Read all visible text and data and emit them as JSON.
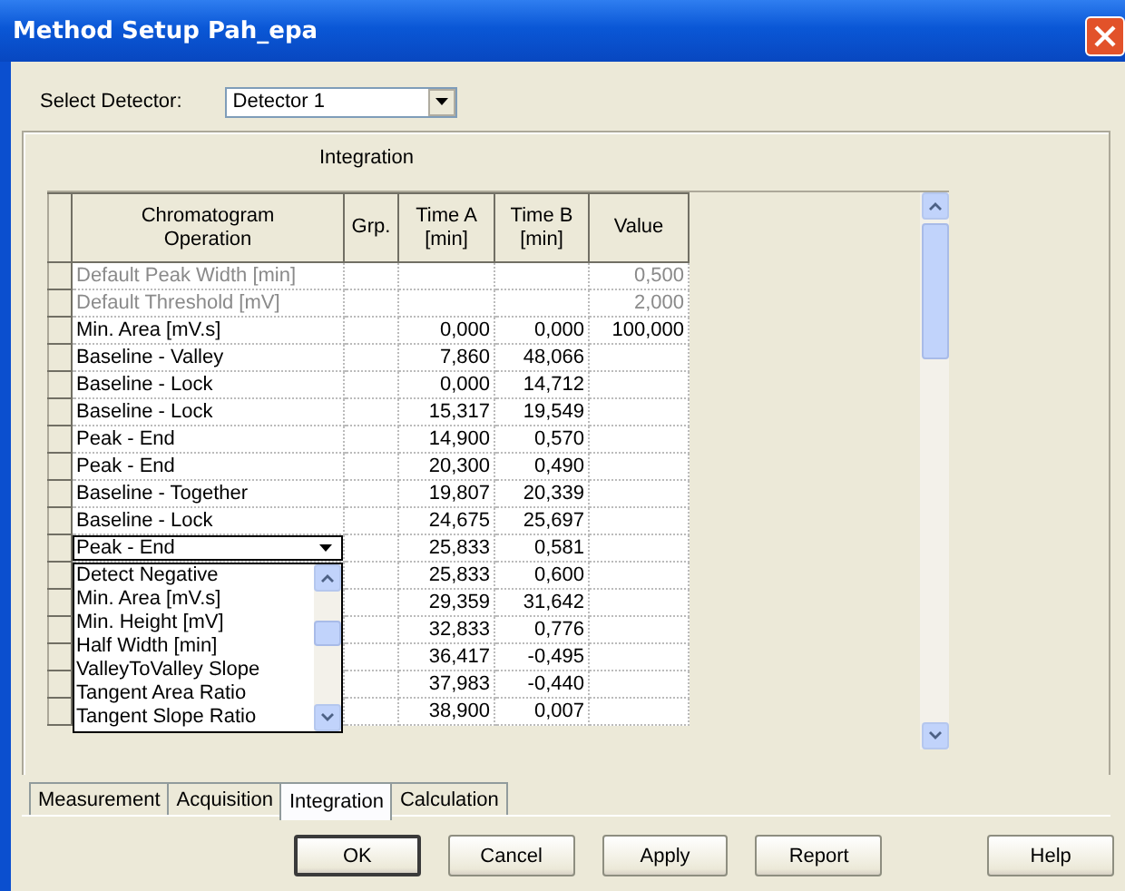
{
  "window": {
    "title": "Method Setup Pah_epa"
  },
  "detector": {
    "label": "Select Detector:",
    "value": "Detector 1"
  },
  "panel_title": "Integration",
  "grid": {
    "columns": [
      "Chromatogram\nOperation",
      "Grp.",
      "Time A\n[min]",
      "Time B\n[min]",
      "Value"
    ],
    "rows": [
      {
        "kind": "default",
        "operation": "Default Peak Width [min]",
        "value": "0,500"
      },
      {
        "kind": "default",
        "operation": "Default Threshold [mV]",
        "value": "2,000"
      },
      {
        "kind": "normal",
        "operation": "Min. Area [mV.s]",
        "time_a": "0,000",
        "time_b": "0,000",
        "value": "100,000"
      },
      {
        "kind": "normal",
        "operation": "Baseline - Valley",
        "time_a": "7,860",
        "time_b": "48,066"
      },
      {
        "kind": "normal",
        "operation": "Baseline - Lock",
        "time_a": "0,000",
        "time_b": "14,712"
      },
      {
        "kind": "normal",
        "operation": "Baseline - Lock",
        "time_a": "15,317",
        "time_b": "19,549"
      },
      {
        "kind": "normal",
        "operation": "Peak - End",
        "time_a": "14,900",
        "time_b": "0,570"
      },
      {
        "kind": "normal",
        "operation": "Peak - End",
        "time_a": "20,300",
        "time_b": "0,490"
      },
      {
        "kind": "normal",
        "operation": "Baseline - Together",
        "time_a": "19,807",
        "time_b": "20,339"
      },
      {
        "kind": "normal",
        "operation": "Baseline - Lock",
        "time_a": "24,675",
        "time_b": "25,697"
      },
      {
        "kind": "editing",
        "operation": "Peak - End",
        "time_a": "25,833",
        "time_b": "0,581"
      },
      {
        "kind": "normal",
        "time_a": "25,833",
        "time_b": "0,600"
      },
      {
        "kind": "normal",
        "time_a": "29,359",
        "time_b": "31,642"
      },
      {
        "kind": "normal",
        "time_a": "32,833",
        "time_b": "0,776"
      },
      {
        "kind": "normal",
        "time_a": "36,417",
        "time_b": "-0,495"
      },
      {
        "kind": "normal",
        "time_a": "37,983",
        "time_b": "-0,440"
      },
      {
        "kind": "normal",
        "time_a": "38,900",
        "time_b": "0,007"
      }
    ]
  },
  "dropdown_list": {
    "items": [
      "Detect Negative",
      "Min. Area [mV.s]",
      "Min. Height [mV]",
      "Half Width [min]",
      "ValleyToValley Slope",
      "Tangent Area Ratio",
      "Tangent Slope Ratio"
    ]
  },
  "tabs": [
    {
      "label": "Measurement",
      "selected": false
    },
    {
      "label": "Acquisition",
      "selected": false
    },
    {
      "label": "Integration",
      "selected": true
    },
    {
      "label": "Calculation",
      "selected": false
    }
  ],
  "buttons": [
    {
      "label": "OK",
      "default": true
    },
    {
      "label": "Cancel",
      "default": false
    },
    {
      "label": "Apply",
      "default": false
    },
    {
      "label": "Report",
      "default": false
    },
    {
      "label": "Help",
      "default": false
    }
  ]
}
